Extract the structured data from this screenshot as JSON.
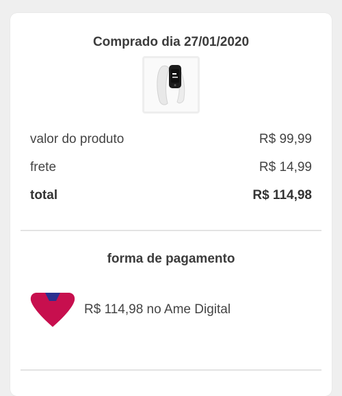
{
  "purchase": {
    "title": "Comprado dia 27/01/2020",
    "product_image_icon": "smart-band-icon"
  },
  "summary": {
    "product_label": "valor do produto",
    "product_value": "R$ 99,99",
    "shipping_label": "frete",
    "shipping_value": "R$ 14,99",
    "total_label": "total",
    "total_value": "R$ 114,98"
  },
  "payment": {
    "title": "forma de pagamento",
    "method_icon": "ame-digital-icon",
    "method_text": "R$ 114,98 no Ame Digital",
    "colors": {
      "ame_red": "#c70f4e",
      "ame_blue": "#2a2f8f"
    }
  }
}
